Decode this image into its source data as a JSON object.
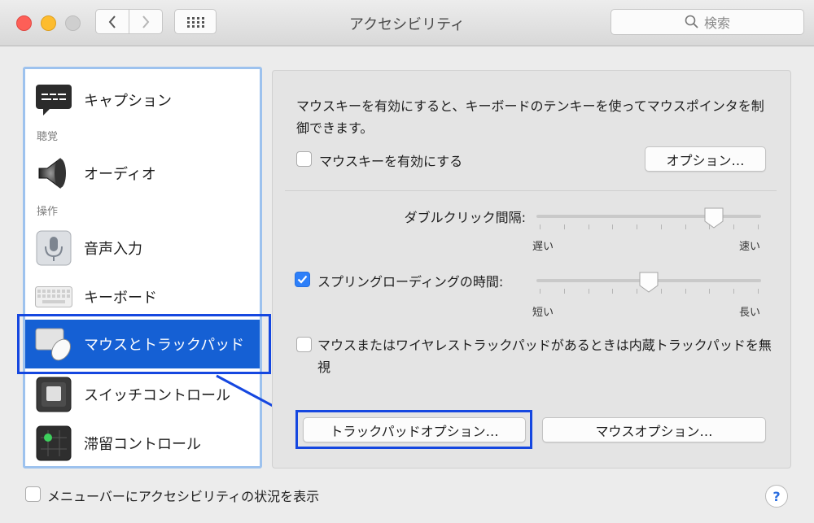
{
  "window": {
    "title": "アクセシビリティ"
  },
  "search": {
    "placeholder": "検索"
  },
  "sidebar": {
    "items": [
      {
        "label": "キャプション",
        "icon": "caption-icon"
      },
      {
        "header": "聴覚"
      },
      {
        "label": "オーディオ",
        "icon": "speaker-icon"
      },
      {
        "header": "操作"
      },
      {
        "label": "音声入力",
        "icon": "microphone-icon"
      },
      {
        "label": "キーボード",
        "icon": "keyboard-icon"
      },
      {
        "label": "マウスとトラックパッド",
        "icon": "mouse-trackpad-icon",
        "selected": true
      },
      {
        "label": "スイッチコントロール",
        "icon": "switch-control-icon"
      },
      {
        "label": "滞留コントロール",
        "icon": "dwell-control-icon"
      }
    ]
  },
  "main": {
    "description": "マウスキーを有効にすると、キーボードのテンキーを使ってマウスポインタを制御できます。",
    "mouse_keys_label": "マウスキーを有効にする",
    "mouse_keys_checked": false,
    "options_button": "オプション…",
    "double_click": {
      "label": "ダブルクリック間隔:",
      "min_label": "遅い",
      "max_label": "速い",
      "value": 0.8
    },
    "spring_loading": {
      "label": "スプリングローディングの時間:",
      "min_label": "短い",
      "max_label": "長い",
      "value": 0.5,
      "checked": true
    },
    "ignore_trackpad_label": "マウスまたはワイヤレストラックパッドがあるときは内蔵トラックパッドを無視",
    "ignore_trackpad_checked": false,
    "trackpad_options_button": "トラックパッドオプション…",
    "mouse_options_button": "マウスオプション…"
  },
  "footer": {
    "menubar_status_label": "メニューバーにアクセシビリティの状況を表示",
    "menubar_status_checked": false,
    "help_label": "?"
  },
  "colors": {
    "selection": "#1560d4",
    "annotation": "#1547e0",
    "checkbox_on": "#2d7ff9"
  }
}
